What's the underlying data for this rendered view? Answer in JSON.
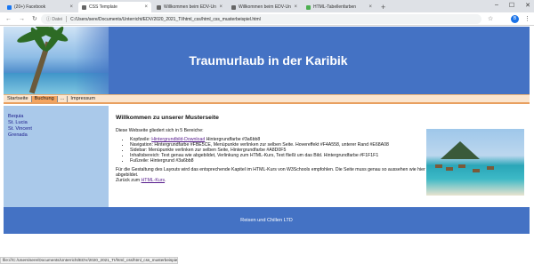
{
  "browser": {
    "tabs": [
      {
        "label": "(20+) Facebook",
        "color": "#1877f2"
      },
      {
        "label": "CSS Template",
        "color": "#666666"
      },
      {
        "label": "Willkommen beim EDV-Unterricht",
        "color": "#666666"
      },
      {
        "label": "Willkommen beim EDV-Unterricht",
        "color": "#666666"
      },
      {
        "label": "HTML-Tabellenfarben",
        "color": "#4caf50"
      }
    ],
    "new_tab": "+",
    "address_label": "Datei",
    "url": "C:/Users/sere/Documents/Unterricht/EDV/2020_2021_TI/html_css/html_css_musterbeispiel.html",
    "profile_initial": "B",
    "status_url": "file:///C:/Users/sere/Documents/Unterricht/EDV/2020_2021_TI/html_css/html_css_musterbeispiel.html"
  },
  "header": {
    "title": "Traumurlaub in der Karibik"
  },
  "topnav": [
    {
      "label": "Startseite",
      "highlight": false
    },
    {
      "label": "Buchung",
      "highlight": true
    },
    {
      "label": "...",
      "highlight": false
    },
    {
      "label": "Impressum",
      "highlight": false
    }
  ],
  "sidebar": [
    "Bequia",
    "St. Lucia",
    "St. Vincent",
    "Grenada"
  ],
  "main": {
    "heading": "Willkommen zu unserer Musterseite",
    "intro": "Diese Webseite gliedert sich in 5 Bereiche:",
    "items": [
      {
        "pre": "Kopfzeile: ",
        "link": "Hintergrundbild-Download",
        "post": " Hintergrundfarbe #3a6bb8"
      },
      {
        "pre": "Navigation: Hintergrundfarbe #FBE5CE, Menüpunkte verlinken zur selben Seite. Hovereffekt #F4A558, unterer Rand #E68A08",
        "link": "",
        "post": ""
      },
      {
        "pre": "Sidebar: Menüpunkte verlinken zur selben Seite, Hintergrundfarbe #A8D0F5",
        "link": "",
        "post": ""
      },
      {
        "pre": "Inhaltsbereich: Text genau wie abgebildet, Verlinkung zum HTML-Kurs, Text fließt um das Bild. Hintergrundfarbe #F1F1F1",
        "link": "",
        "post": ""
      },
      {
        "pre": "Fußzeile: Hintergrund #3a6bb8",
        "link": "",
        "post": ""
      }
    ],
    "outro": "Für die Gestaltung des Layouts wird das entsprechende Kapitel im HTML-Kurs von W3Schools empfohlen. Die Seite muss genau so aussehen wie hier abgebildet.",
    "back_pre": "Zurück zum ",
    "back_link": "HTML-Kurs",
    "back_post": "."
  },
  "footer": {
    "text": "Reisen und Chillen LTD"
  }
}
